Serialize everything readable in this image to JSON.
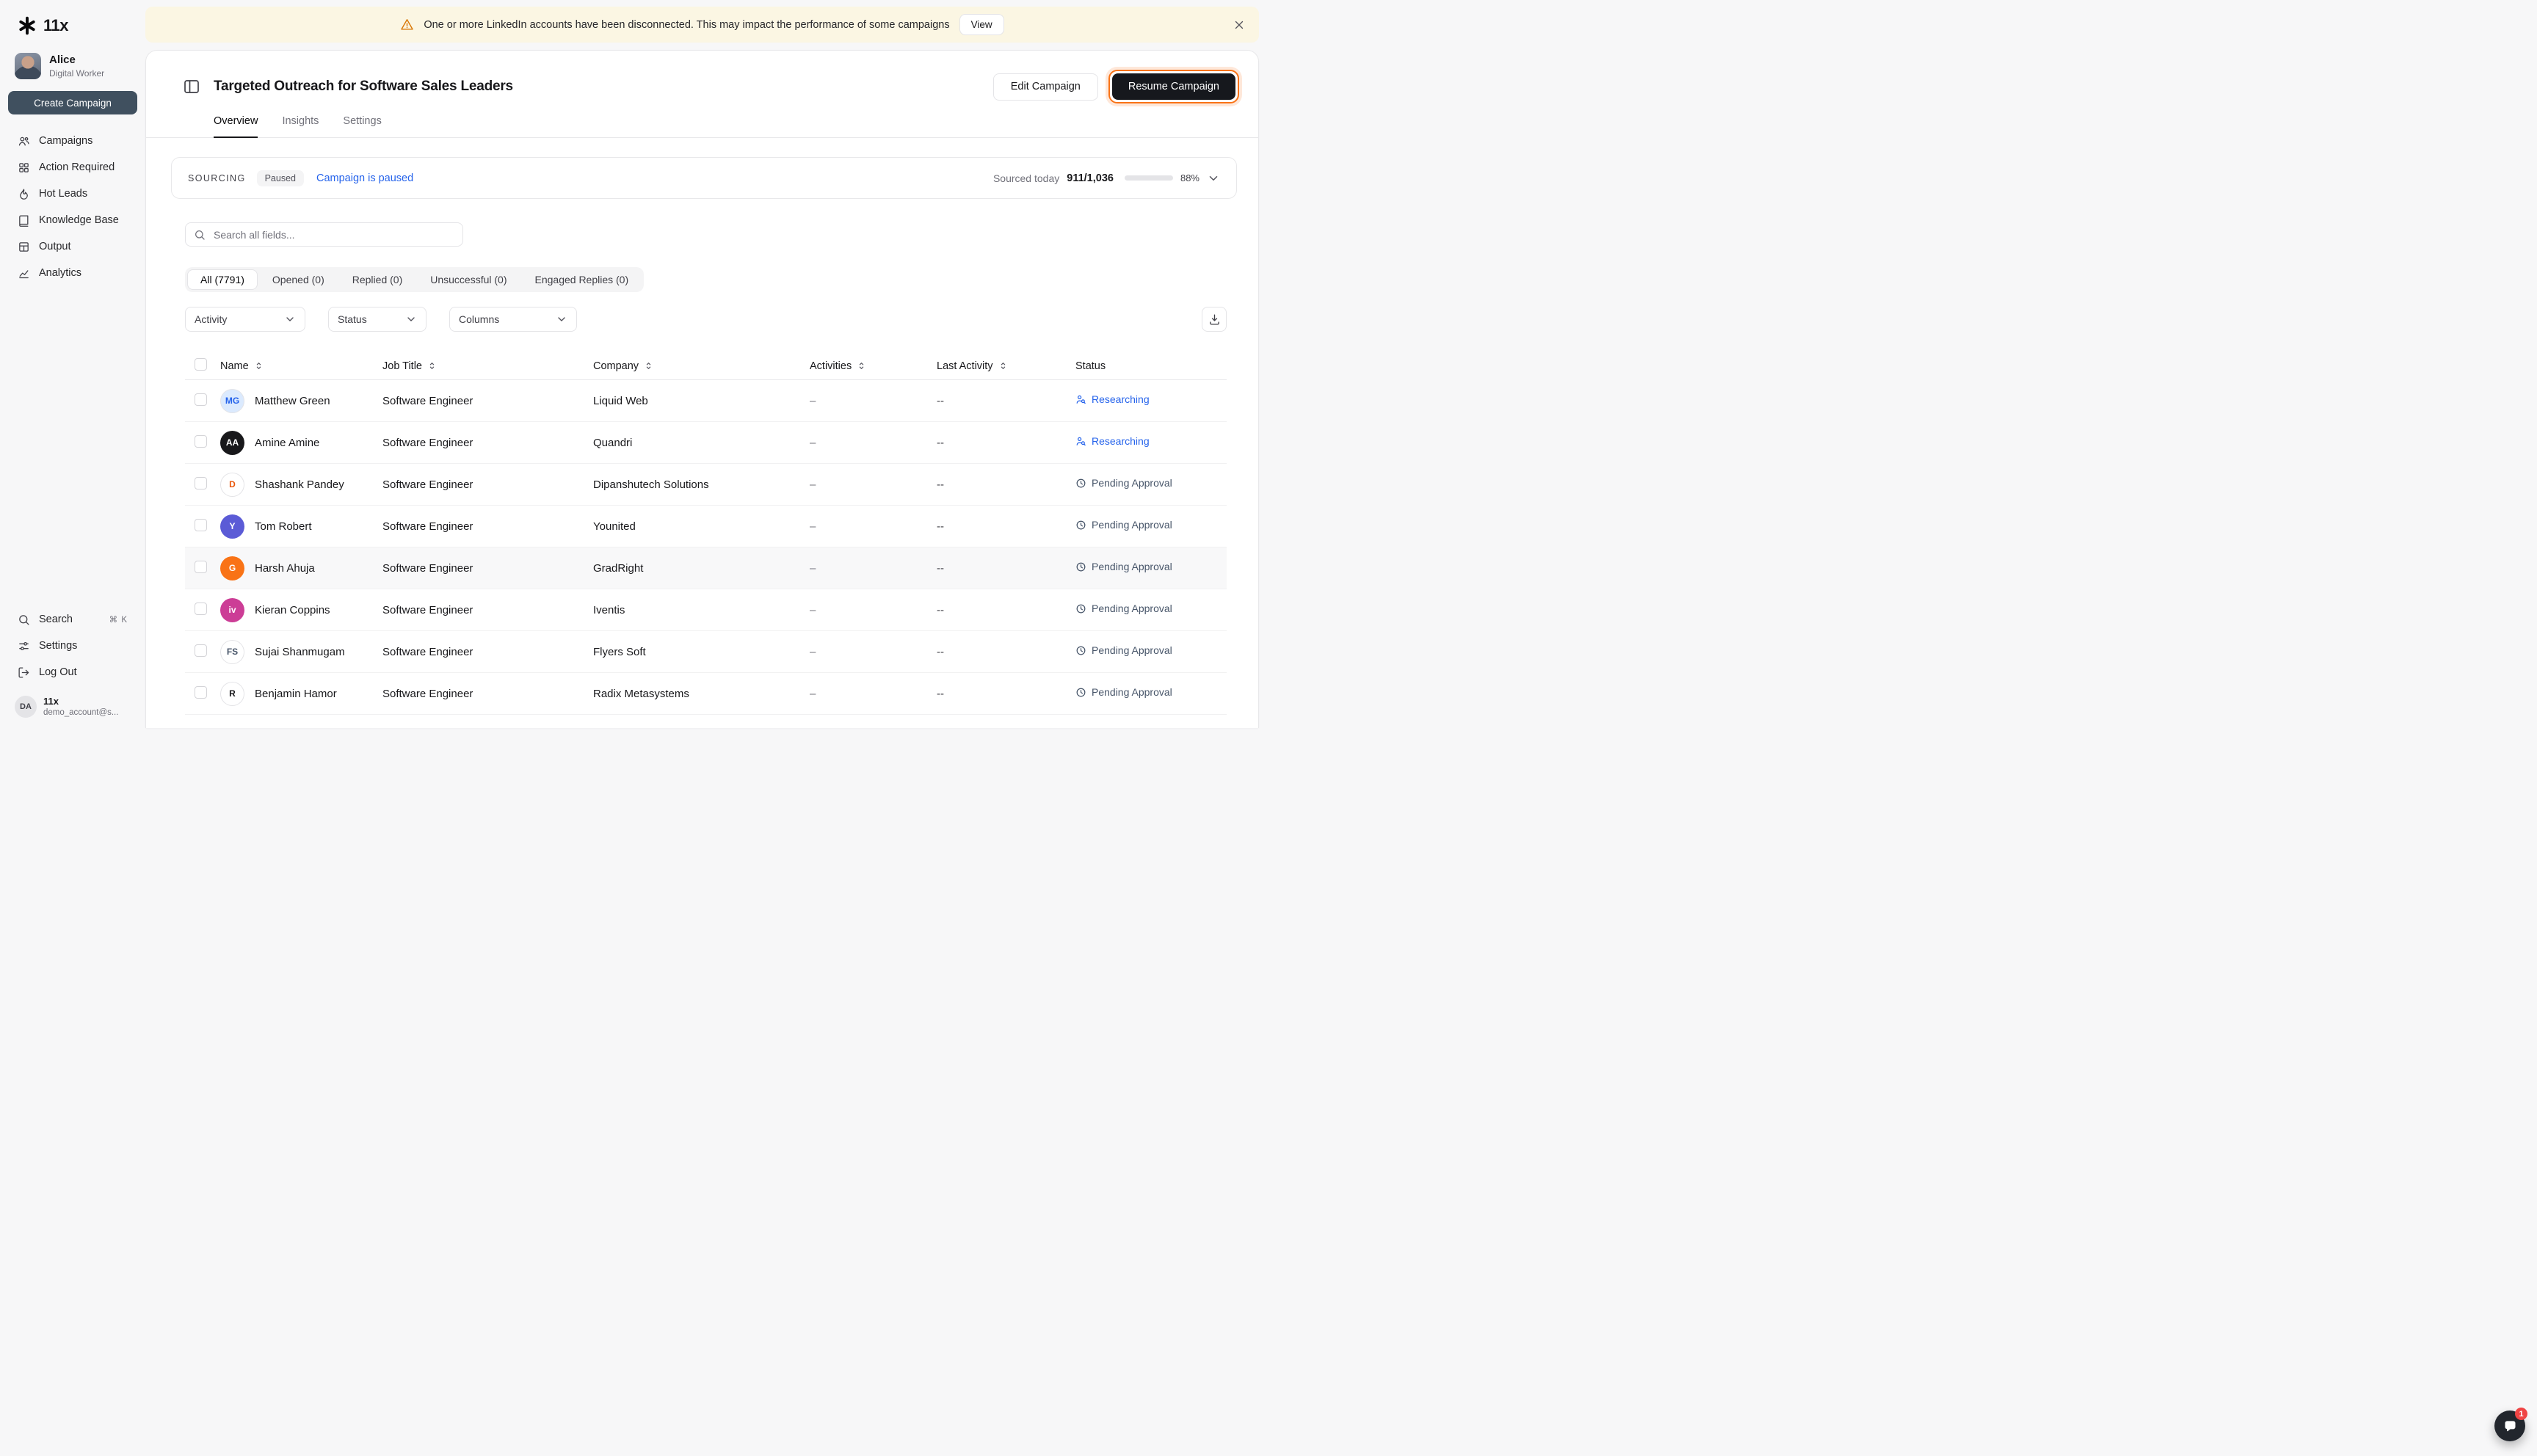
{
  "colors": {
    "accent-orange": "#f97316",
    "brand-dark": "#16181d",
    "link-blue": "#2563eb",
    "status-researching": "#2563eb",
    "status-pending": "#475569"
  },
  "banner": {
    "message": "One or more LinkedIn accounts have been disconnected. This may impact the performance of some campaigns",
    "view_label": "View"
  },
  "sidebar": {
    "logo_text": "11x",
    "user_name": "Alice",
    "user_role": "Digital Worker",
    "create_campaign_label": "Create Campaign",
    "nav": [
      {
        "label": "Campaigns"
      },
      {
        "label": "Action Required"
      },
      {
        "label": "Hot Leads"
      },
      {
        "label": "Knowledge Base"
      },
      {
        "label": "Output"
      },
      {
        "label": "Analytics"
      }
    ],
    "search_label": "Search",
    "search_shortcut": "⌘ K",
    "settings_label": "Settings",
    "logout_label": "Log Out",
    "account_initials": "DA",
    "account_name": "11x",
    "account_email": "demo_account@s..."
  },
  "header": {
    "title": "Targeted Outreach for Software Sales Leaders",
    "edit_label": "Edit Campaign",
    "resume_label": "Resume Campaign",
    "tabs": [
      {
        "label": "Overview"
      },
      {
        "label": "Insights"
      },
      {
        "label": "Settings"
      }
    ]
  },
  "sourcing": {
    "label": "SOURCING",
    "badge": "Paused",
    "status_link": "Campaign is paused",
    "sourced_label": "Sourced today",
    "sourced_value": "911/1,036",
    "percent": 88,
    "percent_label": "88%"
  },
  "toolbar": {
    "search_placeholder": "Search all fields...",
    "tabs": [
      {
        "label": "All (7791)"
      },
      {
        "label": "Opened (0)"
      },
      {
        "label": "Replied (0)"
      },
      {
        "label": "Unsuccessful (0)"
      },
      {
        "label": "Engaged Replies (0)"
      }
    ],
    "dropdowns": [
      {
        "label": "Activity"
      },
      {
        "label": "Status"
      },
      {
        "label": "Columns"
      }
    ]
  },
  "table": {
    "columns": [
      {
        "label": "Name"
      },
      {
        "label": "Job Title"
      },
      {
        "label": "Company"
      },
      {
        "label": "Activities"
      },
      {
        "label": "Last Activity"
      },
      {
        "label": "Status"
      }
    ],
    "rows": [
      {
        "name": "Matthew Green",
        "job": "Software Engineer",
        "company": "Liquid Web",
        "activities": "–",
        "last_activity": "--",
        "status": {
          "label": "Researching",
          "type": "researching"
        },
        "avatar": {
          "initials": "MG",
          "bg": "#dbeafe",
          "fg": "#2563eb",
          "border": true
        }
      },
      {
        "name": "Amine Amine",
        "job": "Software Engineer",
        "company": "Quandri",
        "activities": "–",
        "last_activity": "--",
        "status": {
          "label": "Researching",
          "type": "researching"
        },
        "avatar": {
          "initials": "AA",
          "bg": "#18181b",
          "fg": "#ffffff",
          "border": false
        }
      },
      {
        "name": "Shashank Pandey",
        "job": "Software Engineer",
        "company": "Dipanshutech Solutions",
        "activities": "–",
        "last_activity": "--",
        "status": {
          "label": "Pending Approval",
          "type": "pending"
        },
        "avatar": {
          "initials": "D",
          "bg": "#ffffff",
          "fg": "#ea580c",
          "border": true
        }
      },
      {
        "name": "Tom Robert",
        "job": "Software Engineer",
        "company": "Younited",
        "activities": "–",
        "last_activity": "--",
        "status": {
          "label": "Pending Approval",
          "type": "pending"
        },
        "avatar": {
          "initials": "Y",
          "bg": "#5b5bd6",
          "fg": "#ffffff",
          "border": false
        }
      },
      {
        "name": "Harsh Ahuja",
        "job": "Software Engineer",
        "company": "GradRight",
        "activities": "–",
        "last_activity": "--",
        "status": {
          "label": "Pending Approval",
          "type": "pending"
        },
        "avatar": {
          "initials": "G",
          "bg": "#f97316",
          "fg": "#ffffff",
          "border": false
        },
        "highlighted": true
      },
      {
        "name": "Kieran Coppins",
        "job": "Software Engineer",
        "company": "Iventis",
        "activities": "–",
        "last_activity": "--",
        "status": {
          "label": "Pending Approval",
          "type": "pending"
        },
        "avatar": {
          "initials": "iv",
          "bg": "#cc3d96",
          "fg": "#ffffff",
          "border": false
        }
      },
      {
        "name": "Sujai Shanmugam",
        "job": "Software Engineer",
        "company": "Flyers Soft",
        "activities": "–",
        "last_activity": "--",
        "status": {
          "label": "Pending Approval",
          "type": "pending"
        },
        "avatar": {
          "initials": "FS",
          "bg": "#ffffff",
          "fg": "#475569",
          "border": true
        }
      },
      {
        "name": "Benjamin Hamor",
        "job": "Software Engineer",
        "company": "Radix Metasystems",
        "activities": "–",
        "last_activity": "--",
        "status": {
          "label": "Pending Approval",
          "type": "pending"
        },
        "avatar": {
          "initials": "R",
          "bg": "#ffffff",
          "fg": "#18181b",
          "border": true
        }
      }
    ]
  },
  "chat": {
    "unread_count": "1"
  }
}
